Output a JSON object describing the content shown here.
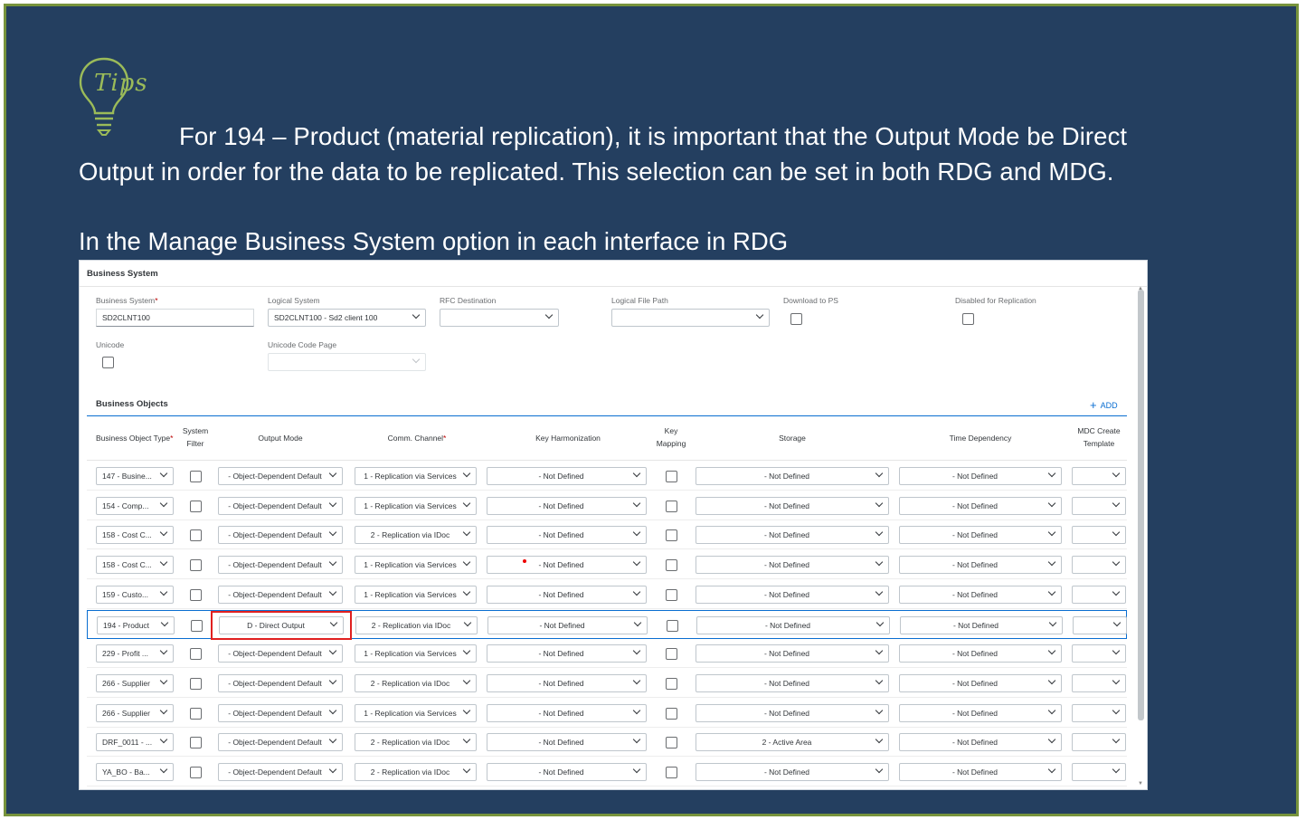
{
  "tip": {
    "logo_text": "Tips",
    "line1": "For 194 – Product (material replication), it is important that the Output Mode be Direct",
    "line2": "Output in order for the data to be replicated. This selection can be set in both RDG and MDG.",
    "subheading": "In the Manage Business System option in each interface in RDG"
  },
  "business_system": {
    "title": "Business System",
    "fields": {
      "business_system_label": "Business System",
      "business_system_value": "SD2CLNT100",
      "logical_system_label": "Logical System",
      "logical_system_value": "SD2CLNT100 - Sd2 client 100",
      "rfc_destination_label": "RFC Destination",
      "rfc_destination_value": "",
      "logical_file_path_label": "Logical File Path",
      "logical_file_path_value": "",
      "download_to_ps_label": "Download to PS",
      "disabled_for_replication_label": "Disabled for Replication",
      "unicode_label": "Unicode",
      "unicode_code_page_label": "Unicode Code Page",
      "unicode_code_page_value": ""
    }
  },
  "business_objects": {
    "title": "Business Objects",
    "add_label": "ADD",
    "columns": {
      "type": "Business Object Type",
      "system_filter_1": "System",
      "system_filter_2": "Filter",
      "output_mode": "Output Mode",
      "comm_channel": "Comm. Channel",
      "key_harmonization": "Key Harmonization",
      "key_mapping_1": "Key",
      "key_mapping_2": "Mapping",
      "storage": "Storage",
      "time_dependency": "Time Dependency",
      "mdc_1": "MDC Create",
      "mdc_2": "Template"
    },
    "rows": [
      {
        "type": "147 - Busine...",
        "output": "- Object-Dependent Default",
        "channel": "1 - Replication via Services",
        "key_harm": "- Not Defined",
        "storage": "- Not Defined",
        "time": "- Not Defined"
      },
      {
        "type": "154 - Comp...",
        "output": "- Object-Dependent Default",
        "channel": "1 - Replication via Services",
        "key_harm": "- Not Defined",
        "storage": "- Not Defined",
        "time": "- Not Defined"
      },
      {
        "type": "158 - Cost C...",
        "output": "- Object-Dependent Default",
        "channel": "2 - Replication via IDoc",
        "key_harm": "- Not Defined",
        "storage": "- Not Defined",
        "time": "- Not Defined"
      },
      {
        "type": "158 - Cost C...",
        "output": "- Object-Dependent Default",
        "channel": "1 - Replication via Services",
        "key_harm": "- Not Defined",
        "storage": "- Not Defined",
        "time": "- Not Defined"
      },
      {
        "type": "159 - Custo...",
        "output": "- Object-Dependent Default",
        "channel": "1 - Replication via Services",
        "key_harm": "- Not Defined",
        "storage": "- Not Defined",
        "time": "- Not Defined"
      },
      {
        "type": "194 - Product",
        "output": "D - Direct Output",
        "channel": "2 - Replication via IDoc",
        "key_harm": "- Not Defined",
        "storage": "- Not Defined",
        "time": "- Not Defined"
      },
      {
        "type": "229 - Profit ...",
        "output": "- Object-Dependent Default",
        "channel": "1 - Replication via Services",
        "key_harm": "- Not Defined",
        "storage": "- Not Defined",
        "time": "- Not Defined"
      },
      {
        "type": "266 - Supplier",
        "output": "- Object-Dependent Default",
        "channel": "2 - Replication via IDoc",
        "key_harm": "- Not Defined",
        "storage": "- Not Defined",
        "time": "- Not Defined"
      },
      {
        "type": "266 - Supplier",
        "output": "- Object-Dependent Default",
        "channel": "1 - Replication via Services",
        "key_harm": "- Not Defined",
        "storage": "- Not Defined",
        "time": "- Not Defined"
      },
      {
        "type": "DRF_0011 - ...",
        "output": "- Object-Dependent Default",
        "channel": "2 - Replication via IDoc",
        "key_harm": "- Not Defined",
        "storage": "2 - Active Area",
        "time": "- Not Defined"
      },
      {
        "type": "YA_BO - Ba...",
        "output": "- Object-Dependent Default",
        "channel": "2 - Replication via IDoc",
        "key_harm": "- Not Defined",
        "storage": "- Not Defined",
        "time": "- Not Defined"
      }
    ]
  },
  "colors": {
    "background": "#243f60",
    "frame_border": "#77933c",
    "highlight": "#e02020",
    "accent": "#0a6ed1"
  }
}
